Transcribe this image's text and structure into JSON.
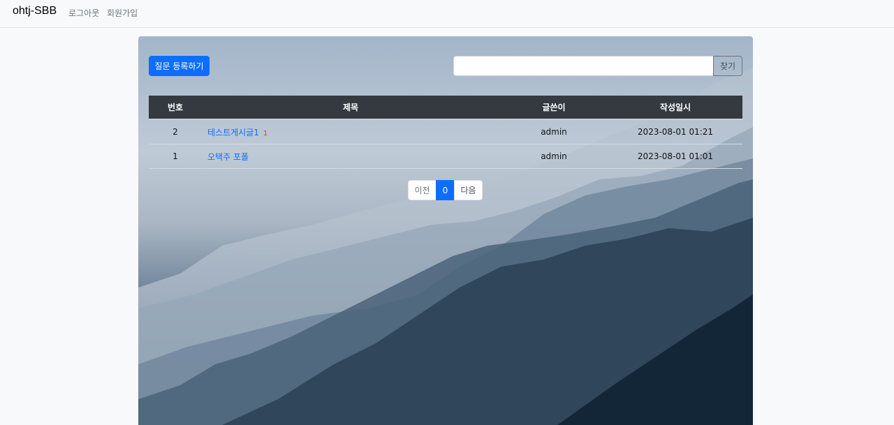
{
  "navbar": {
    "brand": "ohtj-SBB",
    "links": [
      {
        "label": "로그아웃"
      },
      {
        "label": "회원가입"
      }
    ]
  },
  "toolbar": {
    "create_label": "질문 등록하기",
    "search_value": "",
    "search_label": "찾기"
  },
  "table": {
    "headers": {
      "number": "번호",
      "title": "제목",
      "author": "글쓴이",
      "date": "작성일시"
    },
    "rows": [
      {
        "number": "2",
        "title": "테스트게시글1",
        "answers": "1",
        "author": "admin",
        "date": "2023-08-01 01:21"
      },
      {
        "number": "1",
        "title": "오택주 포폴",
        "answers": "",
        "author": "admin",
        "date": "2023-08-01 01:01"
      }
    ]
  },
  "pagination": {
    "prev": "이전",
    "current": "0",
    "next": "다음"
  },
  "colors": {
    "primary": "#0d6efd",
    "header_dark": "#343a40",
    "badge_red": "#dc3545"
  }
}
